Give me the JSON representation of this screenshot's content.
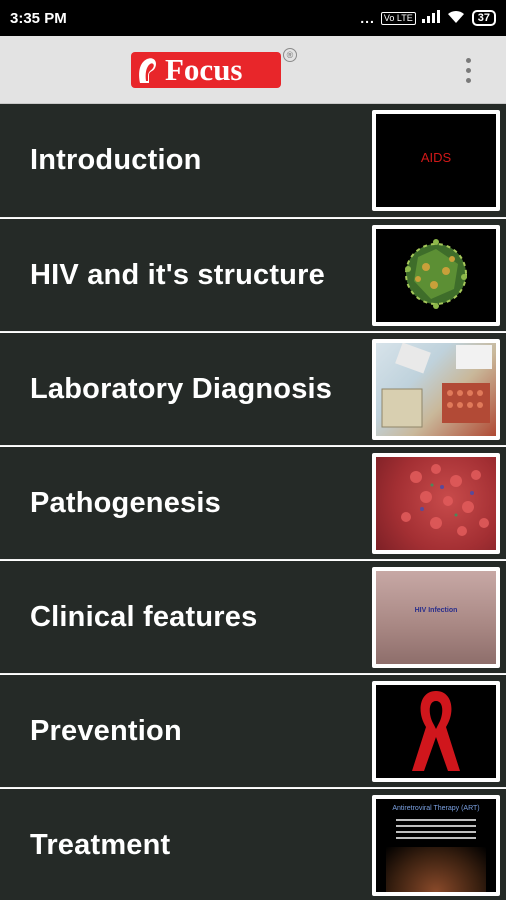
{
  "status_bar": {
    "time": "3:35 PM",
    "signal_dots": "...",
    "volte_badge": "Vo LTE",
    "battery": "37"
  },
  "app_bar": {
    "logo_text": "Focus",
    "registered_mark": "®",
    "menu_icon": "overflow-menu-icon"
  },
  "topics": [
    {
      "label": "Introduction",
      "thumb_title": "AIDS"
    },
    {
      "label": "HIV and it's structure",
      "thumb_title": ""
    },
    {
      "label": "Laboratory Diagnosis",
      "thumb_title": ""
    },
    {
      "label": "Pathogenesis",
      "thumb_title": ""
    },
    {
      "label": "Clinical features",
      "thumb_title": "HIV Infection"
    },
    {
      "label": "Prevention",
      "thumb_title": ""
    },
    {
      "label": "Treatment",
      "thumb_title": "Antiretroviral Therapy (ART)"
    }
  ],
  "colors": {
    "row_background": "#252a27",
    "app_bar": "#e3e3e3",
    "brand_red": "#e8262a"
  }
}
